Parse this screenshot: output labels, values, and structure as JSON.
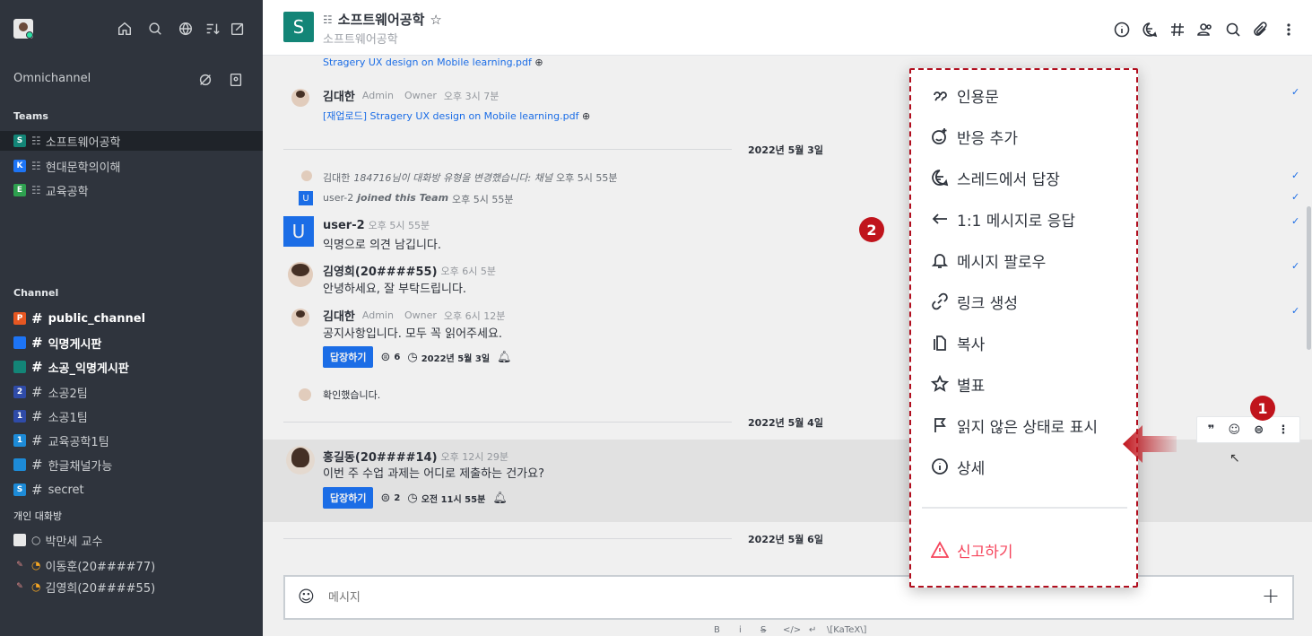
{
  "sidebar": {
    "header_icons": [
      "home-icon",
      "search-icon",
      "directory-icon",
      "sort-icon",
      "compose-icon"
    ],
    "omnichannel": "Omnichannel",
    "teams_title": "Teams",
    "teams": [
      {
        "badge": "S",
        "color": "#138577",
        "label": "소프트웨어공학",
        "selected": true
      },
      {
        "badge": "K",
        "color": "#1d74f5",
        "label": "현대문학의이해"
      },
      {
        "badge": "E",
        "color": "#2ea04f",
        "label": "교육공학"
      }
    ],
    "channel_title": "Channel",
    "channels": [
      {
        "badge": "P",
        "color": "#e65722",
        "label": "public_channel",
        "bold": true
      },
      {
        "badge": "",
        "color": "#1d74f5",
        "label": "익명게시판",
        "bold": true
      },
      {
        "badge": "",
        "color": "#138577",
        "label": "소공_익명게시판",
        "bold": true
      },
      {
        "badge": "2",
        "color": "#2f4ba8",
        "label": "소공2팀"
      },
      {
        "badge": "1",
        "color": "#2f4ba8",
        "label": "소공1팀"
      },
      {
        "badge": "1",
        "color": "#1d8bd8",
        "label": "교육공학1팀"
      },
      {
        "badge": "",
        "color": "#1d8bd8",
        "label": "한글채널가능"
      },
      {
        "badge": "S",
        "color": "#1d8bd8",
        "label": "secret"
      }
    ],
    "dm_title": "개인 대화방",
    "dms": [
      {
        "label": "박만세 교수"
      },
      {
        "label": "이동훈(20####77)"
      },
      {
        "label": "김영희(20####55)"
      }
    ]
  },
  "header": {
    "avatar_letter": "S",
    "title": "소프트웨어공학",
    "subtitle": "소프트웨어공학",
    "icons": [
      "info-icon",
      "threads-icon",
      "channels-icon",
      "members-icon",
      "search-icon",
      "attachment-icon",
      "kebab-icon"
    ]
  },
  "messages": {
    "file1": "Stragery UX design on Mobile learning.pdf",
    "m1": {
      "user": "김대한",
      "role1": "Admin",
      "role2": "Owner",
      "time": "오후 3시 7분",
      "file": "[재업로드] Stragery UX design on Mobile learning.pdf"
    },
    "date1": "2022년 5월 3일",
    "sys1": {
      "user": "김대한",
      "text": "184716님이 대화방 유형을 변경했습니다: 채널",
      "time": "오후 5시 55분"
    },
    "sys2": {
      "user": "user-2",
      "text": "joined this Team",
      "time": "오후 5시 55분"
    },
    "m2": {
      "user": "user-2",
      "time": "오후 5시 55분",
      "text": "익명으로 의견 남깁니다."
    },
    "m3": {
      "user": "김영희(20####55)",
      "time": "오후 6시 5분",
      "text": "안녕하세요, 잘 부탁드립니다."
    },
    "m4": {
      "user": "김대한",
      "role1": "Admin",
      "role2": "Owner",
      "time": "오후 6시 12분",
      "text": "공지사항입니다. 모두 꼭 읽어주세요.",
      "reply": "답장하기",
      "count": "6",
      "date": "2022년 5월 3일"
    },
    "m5": {
      "text": "확인했습니다."
    },
    "date2": "2022년 5월 4일",
    "m6": {
      "user": "홍길동(20####14)",
      "time": "오후 12시 29분",
      "text": "이번 주 수업 과제는 어디로 제출하는 건가요?",
      "reply": "답장하기",
      "count": "2",
      "date": "오전 11시 55분"
    },
    "date3": "2022년 5월 6일"
  },
  "composer": {
    "placeholder": "메시지",
    "format": [
      "B",
      "i",
      "S",
      "</>",
      "↵",
      "\\[KaTeX\\]"
    ]
  },
  "menu": {
    "items": [
      {
        "icon": "quote-icon",
        "label": "인용문"
      },
      {
        "icon": "add-reaction-icon",
        "label": "반응 추가"
      },
      {
        "icon": "thread-reply-icon",
        "label": "스레드에서 답장"
      },
      {
        "icon": "reply-dm-icon",
        "label": "1:1 메시지로 응답"
      },
      {
        "icon": "bell-icon",
        "label": "메시지 팔로우"
      },
      {
        "icon": "link-icon",
        "label": "링크 생성"
      },
      {
        "icon": "copy-icon",
        "label": "복사"
      },
      {
        "icon": "star-icon",
        "label": "별표"
      },
      {
        "icon": "flag-icon",
        "label": "읽지 않은 상태로 표시"
      },
      {
        "icon": "info-icon",
        "label": "상세"
      }
    ],
    "danger": {
      "icon": "warning-icon",
      "label": "신고하기"
    }
  },
  "markers": {
    "one": "1",
    "two": "2"
  },
  "colors": {
    "sidebar": "#2f343d",
    "accent": "#1d74f5",
    "danger": "#f5455c",
    "marker": "#c0141c"
  }
}
